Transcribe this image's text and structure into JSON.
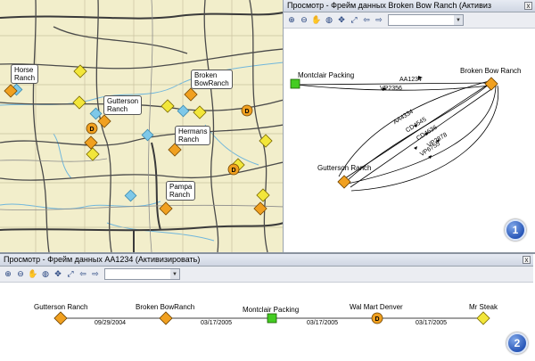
{
  "map": {
    "labels": [
      {
        "id": "horse",
        "text": "Horse\nRanch"
      },
      {
        "id": "broken",
        "text": "Broken\nBowRanch"
      },
      {
        "id": "gutterson",
        "text": "Gutterson\nRanch"
      },
      {
        "id": "hermans",
        "text": "Hermans\nRanch"
      },
      {
        "id": "pampa",
        "text": "Pampa\nRanch"
      }
    ]
  },
  "top_window": {
    "title": "Просмотр - Фрейм данных Broken Bow  Ranch (Активиз",
    "close": "x",
    "nodes": {
      "montclair": "Montclair Packing",
      "broken_bow": "Broken Bow Ranch",
      "gutterson": "Gutterson Ranch"
    },
    "edges": [
      "AA1234",
      "VP2356",
      "AA4334",
      "CD4545",
      "CD4636",
      "VP2878",
      "VP6755"
    ],
    "badge": "1"
  },
  "bottom_window": {
    "title": "Просмотр - Фрейм данных AA1234 (Активизировать)",
    "close": "x",
    "nodes": [
      "Gutterson Ranch",
      "Broken BowRanch",
      "Montclair Packing",
      "Wal Mart Denver",
      "Mr Steak"
    ],
    "dates": [
      "09/29/2004",
      "03/17/2005",
      "03/17/2005",
      "03/17/2005"
    ],
    "badge": "2"
  },
  "toolbar_icons": [
    "zoom-in-icon",
    "zoom-out-icon",
    "pan-hand-icon",
    "globe-icon",
    "full-extent-icon",
    "fixed-zoom-icon",
    "back-arrow-icon",
    "forward-arrow-icon"
  ],
  "colors": {
    "orange": "#f0a020",
    "yellow": "#f2e63a",
    "green": "#44cc22",
    "cyan": "#7ec8e8",
    "badge": "#2a58b8"
  }
}
